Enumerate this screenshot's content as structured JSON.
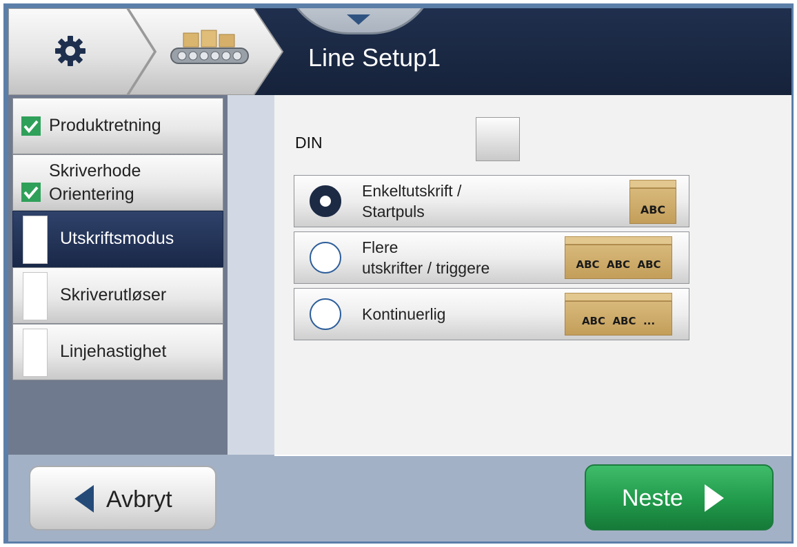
{
  "header": {
    "title": "Line Setup1",
    "breadcrumb_icons": [
      "gear-icon",
      "conveyor-icon"
    ]
  },
  "sidebar": {
    "items": [
      {
        "label": "Produktretning",
        "status": "checked"
      },
      {
        "label": "Skriverhode\nOrientering",
        "status": "checked"
      },
      {
        "label": "Utskriftsmodus",
        "status": "active"
      },
      {
        "label": "Skriverutløser",
        "status": "unset"
      },
      {
        "label": "Linjehastighet",
        "status": "unset"
      }
    ]
  },
  "main": {
    "din_label": "DIN",
    "din_checked": false,
    "options": [
      {
        "line1": "Enkeltutskrift /",
        "line2": "Startpuls",
        "image_text": "ABC",
        "selected": true
      },
      {
        "line1": "Flere",
        "line2": "utskrifter / triggere",
        "image_text": "ABC  ABC  ABC",
        "selected": false
      },
      {
        "line1": "Kontinuerlig",
        "line2": "",
        "image_text": "ABC  ABC  ...",
        "selected": false
      }
    ]
  },
  "footer": {
    "cancel_label": "Avbryt",
    "next_label": "Neste"
  },
  "colors": {
    "header_bg": "#1f2f4d",
    "accent_blue": "#2d5e9a",
    "next_green": "#219a4b",
    "check_green": "#2fa05a"
  }
}
